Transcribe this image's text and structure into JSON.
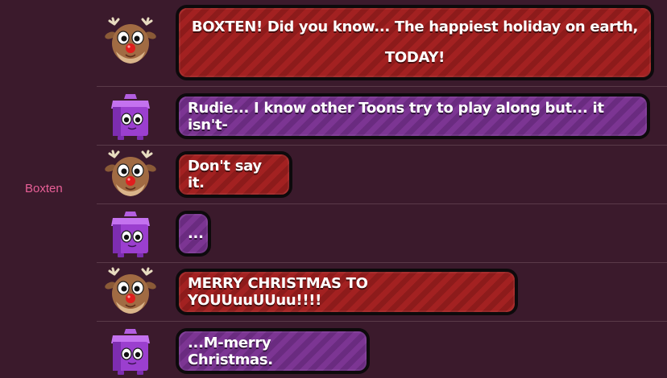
{
  "sidebar": {
    "username": "Boxten"
  },
  "messages": [
    {
      "speaker": "rudie",
      "avatar": "reindeer-icon",
      "color": "#a32121",
      "text": "BOXTEN! Did you know... The happiest holiday on earth, TODAY!"
    },
    {
      "speaker": "boxten",
      "avatar": "purple-box-icon",
      "color": "#7c3593",
      "text": "Rudie... I know other Toons try to play along but... it isn't-"
    },
    {
      "speaker": "rudie",
      "avatar": "reindeer-icon",
      "color": "#a32121",
      "text": "Don't say it."
    },
    {
      "speaker": "boxten",
      "avatar": "purple-box-icon",
      "color": "#7c3593",
      "text": "..."
    },
    {
      "speaker": "rudie",
      "avatar": "reindeer-icon",
      "color": "#a32121",
      "text": "MERRY CHRISTMAS TO YOUUuuUUuu!!!!"
    },
    {
      "speaker": "boxten",
      "avatar": "purple-box-icon",
      "color": "#7c3593",
      "text": "...M-merry Christmas."
    }
  ]
}
